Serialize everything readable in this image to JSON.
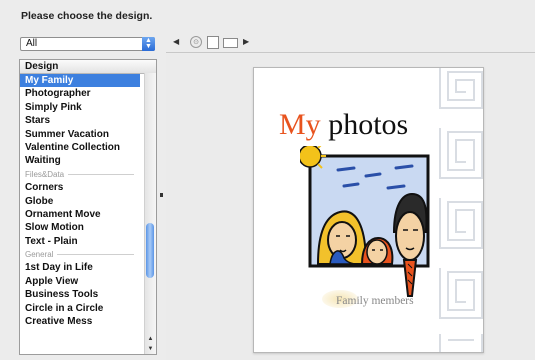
{
  "header": {
    "title": "Please choose the design."
  },
  "filter": {
    "selected": "All"
  },
  "list": {
    "column_header": "Design",
    "rows": [
      {
        "label": "My Family",
        "type": "item",
        "selected": true
      },
      {
        "label": "Photographer",
        "type": "item"
      },
      {
        "label": "Simply Pink",
        "type": "item"
      },
      {
        "label": "Stars",
        "type": "item"
      },
      {
        "label": "Summer Vacation",
        "type": "item"
      },
      {
        "label": "Valentine Collection",
        "type": "item"
      },
      {
        "label": "Waiting",
        "type": "item"
      },
      {
        "label": "Files&Data",
        "type": "category"
      },
      {
        "label": "Corners",
        "type": "item"
      },
      {
        "label": "Globe",
        "type": "item"
      },
      {
        "label": "Ornament Move",
        "type": "item"
      },
      {
        "label": "Slow Motion",
        "type": "item"
      },
      {
        "label": "Text - Plain",
        "type": "item"
      },
      {
        "label": "General",
        "type": "category"
      },
      {
        "label": "1st Day in Life",
        "type": "item"
      },
      {
        "label": "Apple View",
        "type": "item"
      },
      {
        "label": "Business Tools",
        "type": "item"
      },
      {
        "label": "Circle in a Circle",
        "type": "item"
      },
      {
        "label": "Creative Mess",
        "type": "item"
      }
    ]
  },
  "toolbar": {
    "prev_icon": "left-arrow-icon",
    "slideshow_icon": "slideshow-icon",
    "portrait_icon": "portrait-page-icon",
    "landscape_icon": "landscape-page-icon",
    "next_icon": "right-arrow-icon"
  },
  "preview": {
    "title_accent": "My",
    "title_rest": " photos",
    "caption": "Family members",
    "accent_color": "#e8531e"
  },
  "colors": {
    "selection": "#3d80df",
    "background": "#ececec"
  }
}
